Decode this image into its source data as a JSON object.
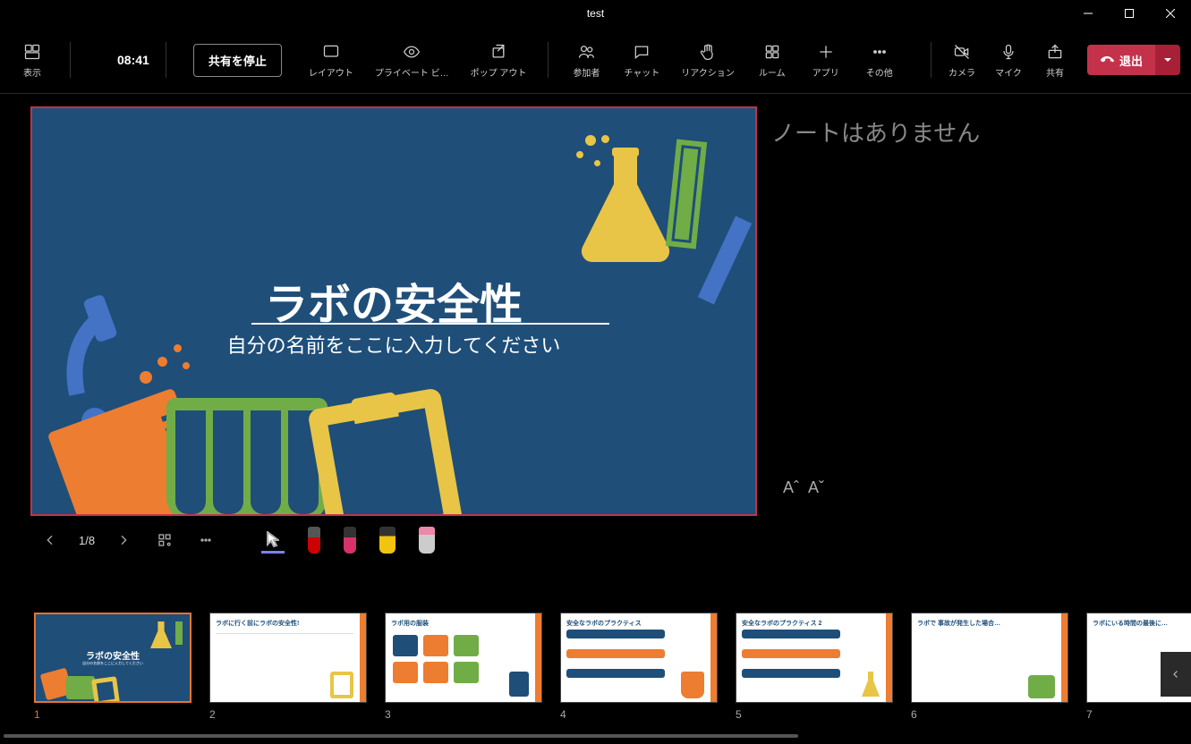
{
  "titlebar": {
    "title": "test"
  },
  "toolbar": {
    "view": "表示",
    "timer": "08:41",
    "stop_sharing": "共有を停止",
    "layout": "レイアウト",
    "private": "プライベート ビ…",
    "popout": "ポップ アウト",
    "participants": "参加者",
    "chat": "チャット",
    "reactions": "リアクション",
    "room": "ルーム",
    "apps": "アプリ",
    "more": "その他",
    "camera": "カメラ",
    "mic": "マイク",
    "share": "共有",
    "leave": "退出"
  },
  "slide": {
    "title": "ラボの安全性",
    "subtitle": "自分の名前をここに入力してください"
  },
  "notes": "ノートはありません",
  "font_ctl": {
    "inc": "Aˆ",
    "dec": "Aˇ"
  },
  "page": "1/8",
  "thumbs": [
    {
      "num": "1",
      "bg": "blue",
      "selected": true,
      "title": "ラボの安全性",
      "sub": "自分の名前をここに入力してください"
    },
    {
      "num": "2",
      "bg": "white",
      "selected": false,
      "title": "ラボに行く前にラボの安全性!"
    },
    {
      "num": "3",
      "bg": "white",
      "selected": false,
      "title": "ラボ用の服装"
    },
    {
      "num": "4",
      "bg": "white",
      "selected": false,
      "title": "安全なラボのプラクティス"
    },
    {
      "num": "5",
      "bg": "white",
      "selected": false,
      "title": "安全なラボのプラクティス 2"
    },
    {
      "num": "6",
      "bg": "white",
      "selected": false,
      "title": "ラボで 事故が発生した場合…"
    },
    {
      "num": "7",
      "bg": "white",
      "selected": false,
      "title": "ラボにいる時間の最後に…"
    }
  ]
}
